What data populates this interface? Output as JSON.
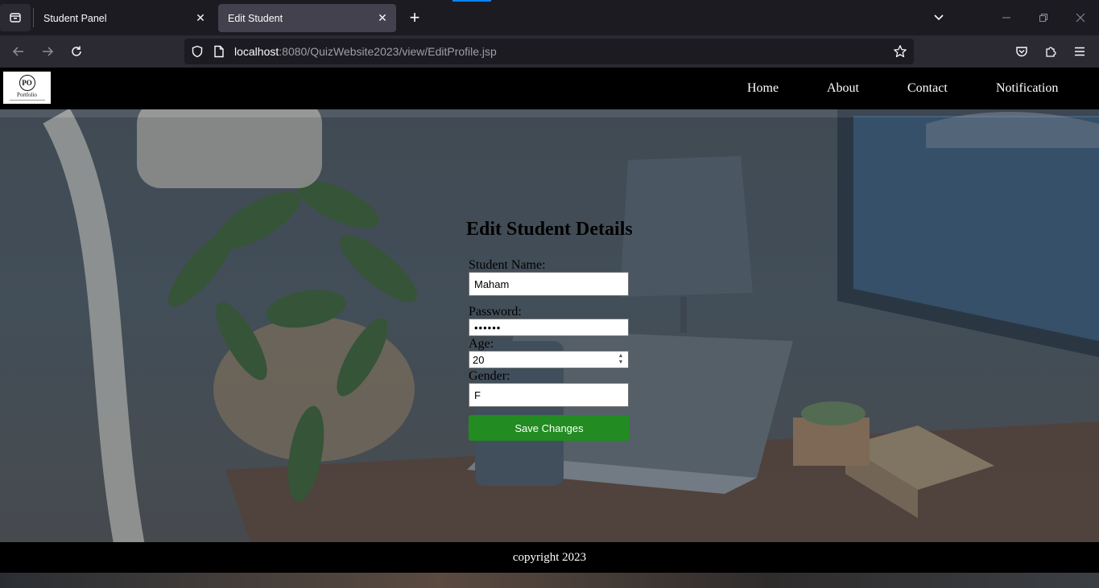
{
  "browser": {
    "tabs": [
      {
        "title": "Student Panel",
        "active": false
      },
      {
        "title": "Edit Student",
        "active": true
      }
    ],
    "url": {
      "host": "localhost",
      "path": ":8080/QuizWebsite2023/view/EditProfile.jsp"
    }
  },
  "site": {
    "logo": {
      "monogram": "PO",
      "word": "Portfolio"
    },
    "nav": [
      "Home",
      "About",
      "Contact",
      "Notification"
    ]
  },
  "form": {
    "title": "Edit Student Details",
    "name_label": "Student Name:",
    "name_value": "Maham",
    "password_label": "Password:",
    "password_value": "••••••",
    "age_label": "Age:",
    "age_value": "20",
    "gender_label": "Gender:",
    "gender_value": "F",
    "submit_label": "Save Changes"
  },
  "footer": {
    "text": "copyright 2023"
  },
  "colors": {
    "save_button": "#228b22",
    "header": "#000000",
    "tab_active": "#42414d"
  }
}
